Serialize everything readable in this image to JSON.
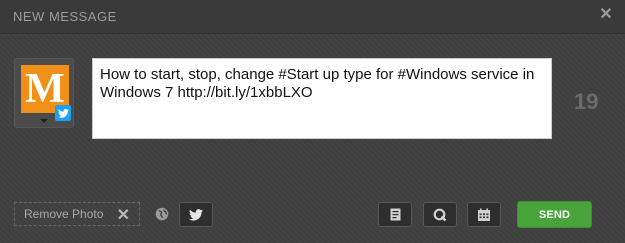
{
  "dialog": {
    "title": "NEW MESSAGE",
    "close_icon": "close-icon"
  },
  "profile": {
    "avatar_letter": "M",
    "avatar_color": "#f09016",
    "network_icon": "twitter-icon",
    "caret_icon": "caret-down-icon"
  },
  "composer": {
    "text": "How to start, stop, change #Start up type for #Windows service in Windows 7 http://bit.ly/1xbbLXO",
    "remaining_chars": "19"
  },
  "footer": {
    "remove_photo_label": "Remove Photo",
    "remove_icon": "close-icon",
    "privacy_icon": "globe-icon",
    "twitter_button_icon": "twitter-icon",
    "pages_button_icon": "document-icon",
    "q_button_icon": "q-icon",
    "calendar_button_icon": "calendar-icon",
    "send_label": "SEND",
    "send_color": "#48a43a"
  }
}
